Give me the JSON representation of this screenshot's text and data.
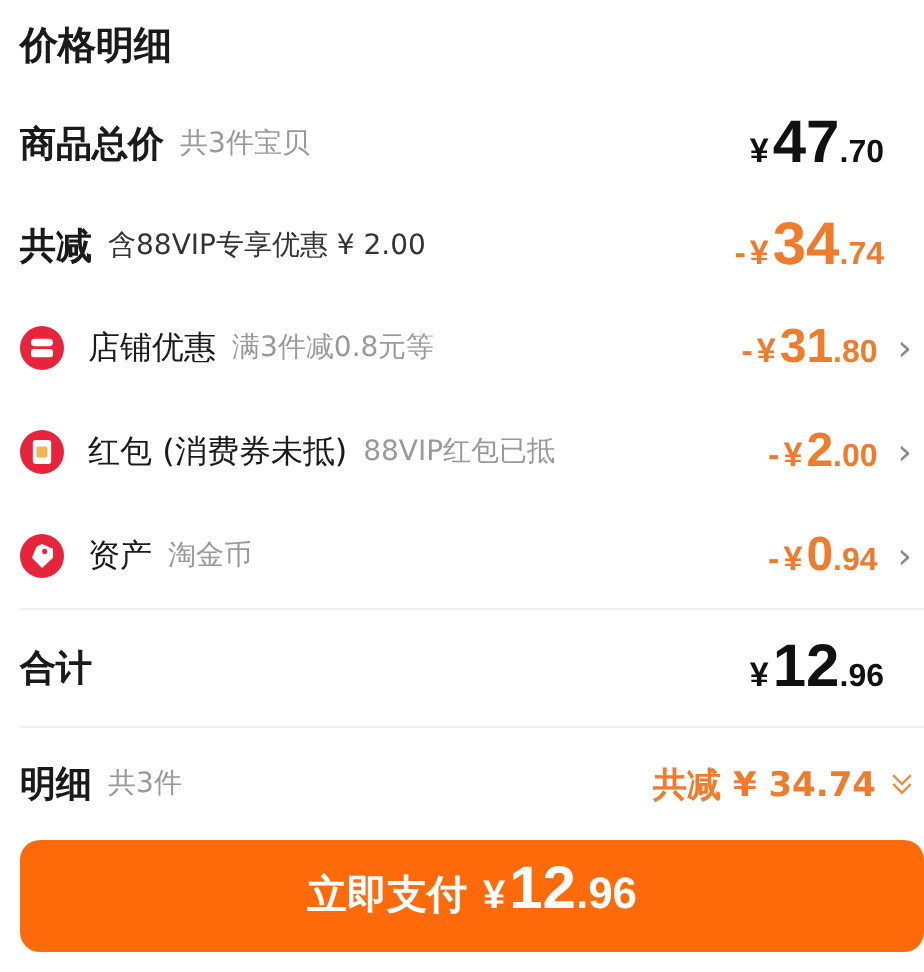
{
  "title": "价格明细",
  "summary": [
    {
      "label": "商品总价",
      "note": "共3件宝贝",
      "price": {
        "currency": "¥",
        "integer": "47",
        "decimal": ".70"
      },
      "highlight": false
    },
    {
      "label": "共减",
      "note": "含88VIP专享优惠 ¥ 2.00",
      "price": {
        "sign": "-",
        "currency": "¥",
        "integer": "34",
        "decimal": ".74"
      },
      "highlight": true
    }
  ],
  "discounts": [
    {
      "kind": "shop",
      "label": "店铺优惠",
      "note": "满3件减0.8元等",
      "price": {
        "sign": "-",
        "currency": "¥",
        "integer": "31",
        "decimal": ".80"
      },
      "chevron": "›"
    },
    {
      "kind": "envelope",
      "label": "红包 (消费券未抵)",
      "note": "88VIP红包已抵",
      "price": {
        "sign": "-",
        "currency": "¥",
        "integer": "2",
        "decimal": ".00"
      },
      "chevron": "›"
    },
    {
      "kind": "asset",
      "label": "资产",
      "note": "淘金币",
      "price": {
        "sign": "-",
        "currency": "¥",
        "integer": "0",
        "decimal": ".94"
      },
      "chevron": "›"
    }
  ],
  "total": {
    "label": "合计",
    "price": {
      "currency": "¥",
      "integer": "12",
      "decimal": ".96"
    }
  },
  "detail": {
    "label": "明细",
    "note": "共3件",
    "saving": "共减 ¥ 34.74"
  },
  "pay_button": {
    "label": "立即支付",
    "price": {
      "currency": "¥",
      "integer": "12",
      "decimal": ".96"
    }
  }
}
